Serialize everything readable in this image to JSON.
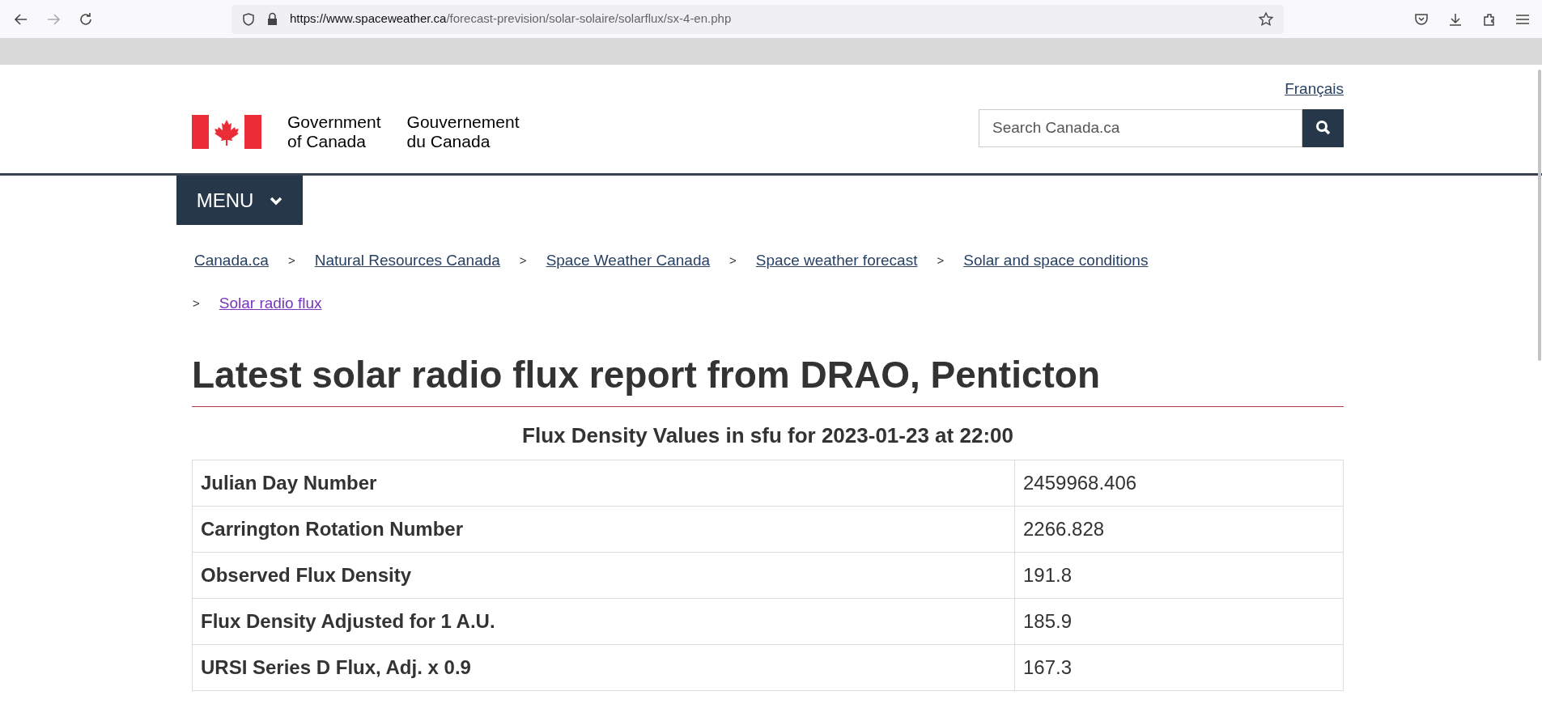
{
  "browser": {
    "url_host": "https://www.spaceweather.ca",
    "url_path": "/forecast-prevision/solar-solaire/solarflux/sx-4-en.php"
  },
  "header": {
    "language_link": "Français",
    "signature_en": [
      "Government",
      "of Canada"
    ],
    "signature_fr": [
      "Gouvernement",
      "du Canada"
    ],
    "search": {
      "placeholder": "Search Canada.ca"
    },
    "menu": "MENU"
  },
  "breadcrumbs": [
    {
      "label": "Canada.ca",
      "visited": false
    },
    {
      "label": "Natural Resources Canada",
      "visited": false
    },
    {
      "label": "Space Weather Canada",
      "visited": false
    },
    {
      "label": "Space weather forecast",
      "visited": false
    },
    {
      "label": "Solar and space conditions",
      "visited": false
    },
    {
      "label": "Solar radio flux",
      "visited": true
    }
  ],
  "breadcrumb_separator": ">",
  "title": "Latest solar radio flux report from DRAO, Penticton",
  "table": {
    "caption": "Flux Density Values in sfu for 2023-01-23 at 22:00",
    "rows": [
      {
        "label": "Julian Day Number",
        "value": "2459968.406"
      },
      {
        "label": "Carrington Rotation Number",
        "value": "2266.828"
      },
      {
        "label": "Observed Flux Density",
        "value": "191.8"
      },
      {
        "label": "Flux Density Adjusted for 1 A.U.",
        "value": "185.9"
      },
      {
        "label": "URSI Series D Flux, Adj. x 0.9",
        "value": "167.3"
      }
    ]
  }
}
